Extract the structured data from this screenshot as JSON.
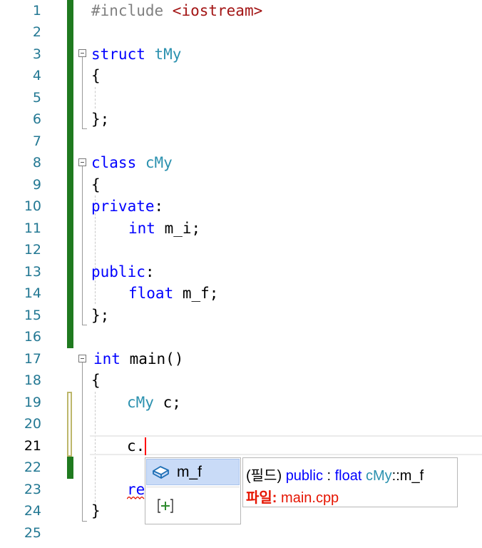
{
  "editor": {
    "line_numbers": [
      "1",
      "2",
      "3",
      "4",
      "5",
      "6",
      "7",
      "8",
      "9",
      "10",
      "11",
      "12",
      "13",
      "14",
      "15",
      "16",
      "17",
      "18",
      "19",
      "20",
      "21",
      "22",
      "23",
      "24",
      "25"
    ],
    "current_line": "21",
    "code": {
      "l1_directive": "#include ",
      "l1_header": "<iostream>",
      "l3_kw": "struct",
      "l3_name": "tMy",
      "l4": "{",
      "l6": "};",
      "l8_kw": "class",
      "l8_name": "cMy",
      "l9": "{",
      "l10_kw": "private",
      "l10_colon": ":",
      "l11_type": "int",
      "l11_rest": " m_i;",
      "l13_kw": "public",
      "l13_colon": ":",
      "l14_type": "float",
      "l14_rest": " m_f;",
      "l15": "};",
      "l17_kw": "int",
      "l17_rest": " main()",
      "l18": "{",
      "l19_type": "cMy",
      "l19_rest": " c;",
      "l21": "c.",
      "l23_partial": "re",
      "l24": "}"
    }
  },
  "completion": {
    "item_label": "m_f",
    "item_icon": "field-icon",
    "action_icon": "expand-icon"
  },
  "tooltip": {
    "kind": "(필드)",
    "access": "public",
    "colon": " : ",
    "type": "float",
    "class_name": "cMy",
    "scope_member": "::m_f",
    "file_label": "파일:",
    "file_name": "main.cpp"
  },
  "colors": {
    "keyword": "#0000ff",
    "type": "#2b91af",
    "string": "#a31515",
    "line_number": "#237893",
    "changed_bar": "#1f7a1f",
    "tooltip_file": "#e51400"
  }
}
